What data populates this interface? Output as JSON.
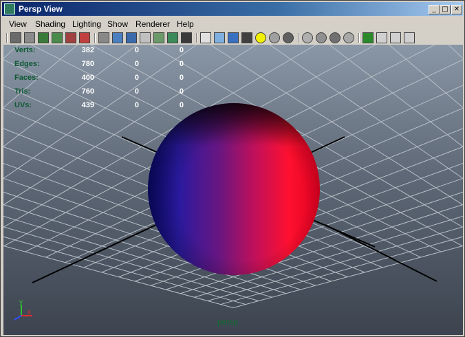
{
  "window": {
    "title": "Persp View"
  },
  "titlebar_buttons": {
    "minimize": "_",
    "maximize": "□",
    "close": "✕"
  },
  "menu": [
    "View",
    "Shading",
    "Lighting",
    "Show",
    "Renderer",
    "Help"
  ],
  "toolbar_icons": [
    "camera-attributes-icon",
    "bookmark-icon",
    "image-plane-icon",
    "grid-toggle-icon",
    "film-gate-icon",
    "resolution-gate-icon",
    "wireframe-icon",
    "smooth-shade-icon",
    "flat-shade-icon",
    "bounding-box-icon",
    "points-icon",
    "texture-icon",
    "text-icon",
    "cube-wire-icon",
    "cube-shaded-icon",
    "cube-blue-icon",
    "checker-icon",
    "light-bulb-icon",
    "sphere-gray-icon",
    "sphere-dark-icon",
    "isolate-icon",
    "ao-icon",
    "shadows-icon",
    "xray-icon",
    "select-highlight-icon",
    "cube-outline-icon",
    "frame-icon",
    "share-icon"
  ],
  "hud_stats": [
    {
      "label": "Verts:",
      "v1": "382",
      "v2": "0",
      "v3": "0"
    },
    {
      "label": "Edges:",
      "v1": "780",
      "v2": "0",
      "v3": "0"
    },
    {
      "label": "Faces:",
      "v1": "400",
      "v2": "0",
      "v3": "0"
    },
    {
      "label": "Tris:",
      "v1": "760",
      "v2": "0",
      "v3": "0"
    },
    {
      "label": "UVs:",
      "v1": "439",
      "v2": "0",
      "v3": "0"
    }
  ],
  "axis": {
    "y": "y",
    "x": "x"
  },
  "camera_label": "persp",
  "colors": {
    "sphere_left": "#1a1aa8",
    "sphere_right": "#ff1030",
    "hud_label": "#0f5a34",
    "grid": "#b8c0c8"
  }
}
